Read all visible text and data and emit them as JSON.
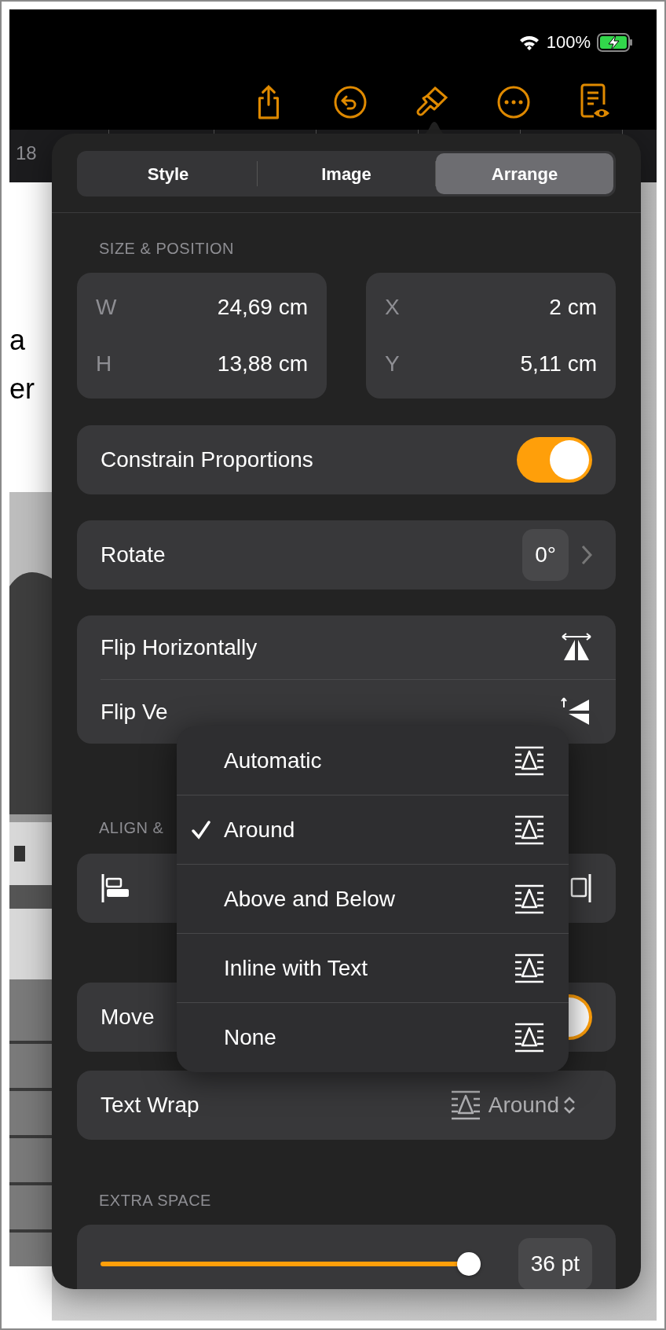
{
  "status_bar": {
    "battery": "100%"
  },
  "ruler": {
    "number": "18"
  },
  "document": {
    "lines": [
      "a",
      "er"
    ],
    "photo": {
      "kind": "picture"
    }
  },
  "tabs": [
    {
      "label": "Style",
      "selected": false
    },
    {
      "label": "Image",
      "selected": false
    },
    {
      "label": "Arrange",
      "selected": true
    }
  ],
  "size_position": {
    "title": "SIZE & POSITION",
    "fields": [
      {
        "label": "W",
        "value": "24,69 cm"
      },
      {
        "label": "H",
        "value": "13,88 cm"
      },
      {
        "label": "X",
        "value": "2 cm"
      },
      {
        "label": "Y",
        "value": "5,11 cm"
      }
    ]
  },
  "constrain_proportions": {
    "label": "Constrain Proportions",
    "on": true
  },
  "rotate": {
    "label": "Rotate",
    "value": "0°"
  },
  "flip": [
    {
      "label": "Flip Horizontally"
    },
    {
      "label": "Flip Ve"
    }
  ],
  "align": {
    "title": "ALIGN &"
  },
  "move_with_text": {
    "label": "Move",
    "on": true
  },
  "text_wrap": {
    "label": "Text Wrap",
    "value": "Around"
  },
  "extra_space": {
    "title": "EXTRA SPACE",
    "level": 1,
    "reading": "36 pt"
  },
  "wrap_menu": [
    {
      "label": "Automatic",
      "selected": false
    },
    {
      "label": "Around",
      "selected": true
    },
    {
      "label": "Above and Below",
      "selected": false
    },
    {
      "label": "Inline with Text",
      "selected": false
    },
    {
      "label": "None",
      "selected": false
    }
  ]
}
